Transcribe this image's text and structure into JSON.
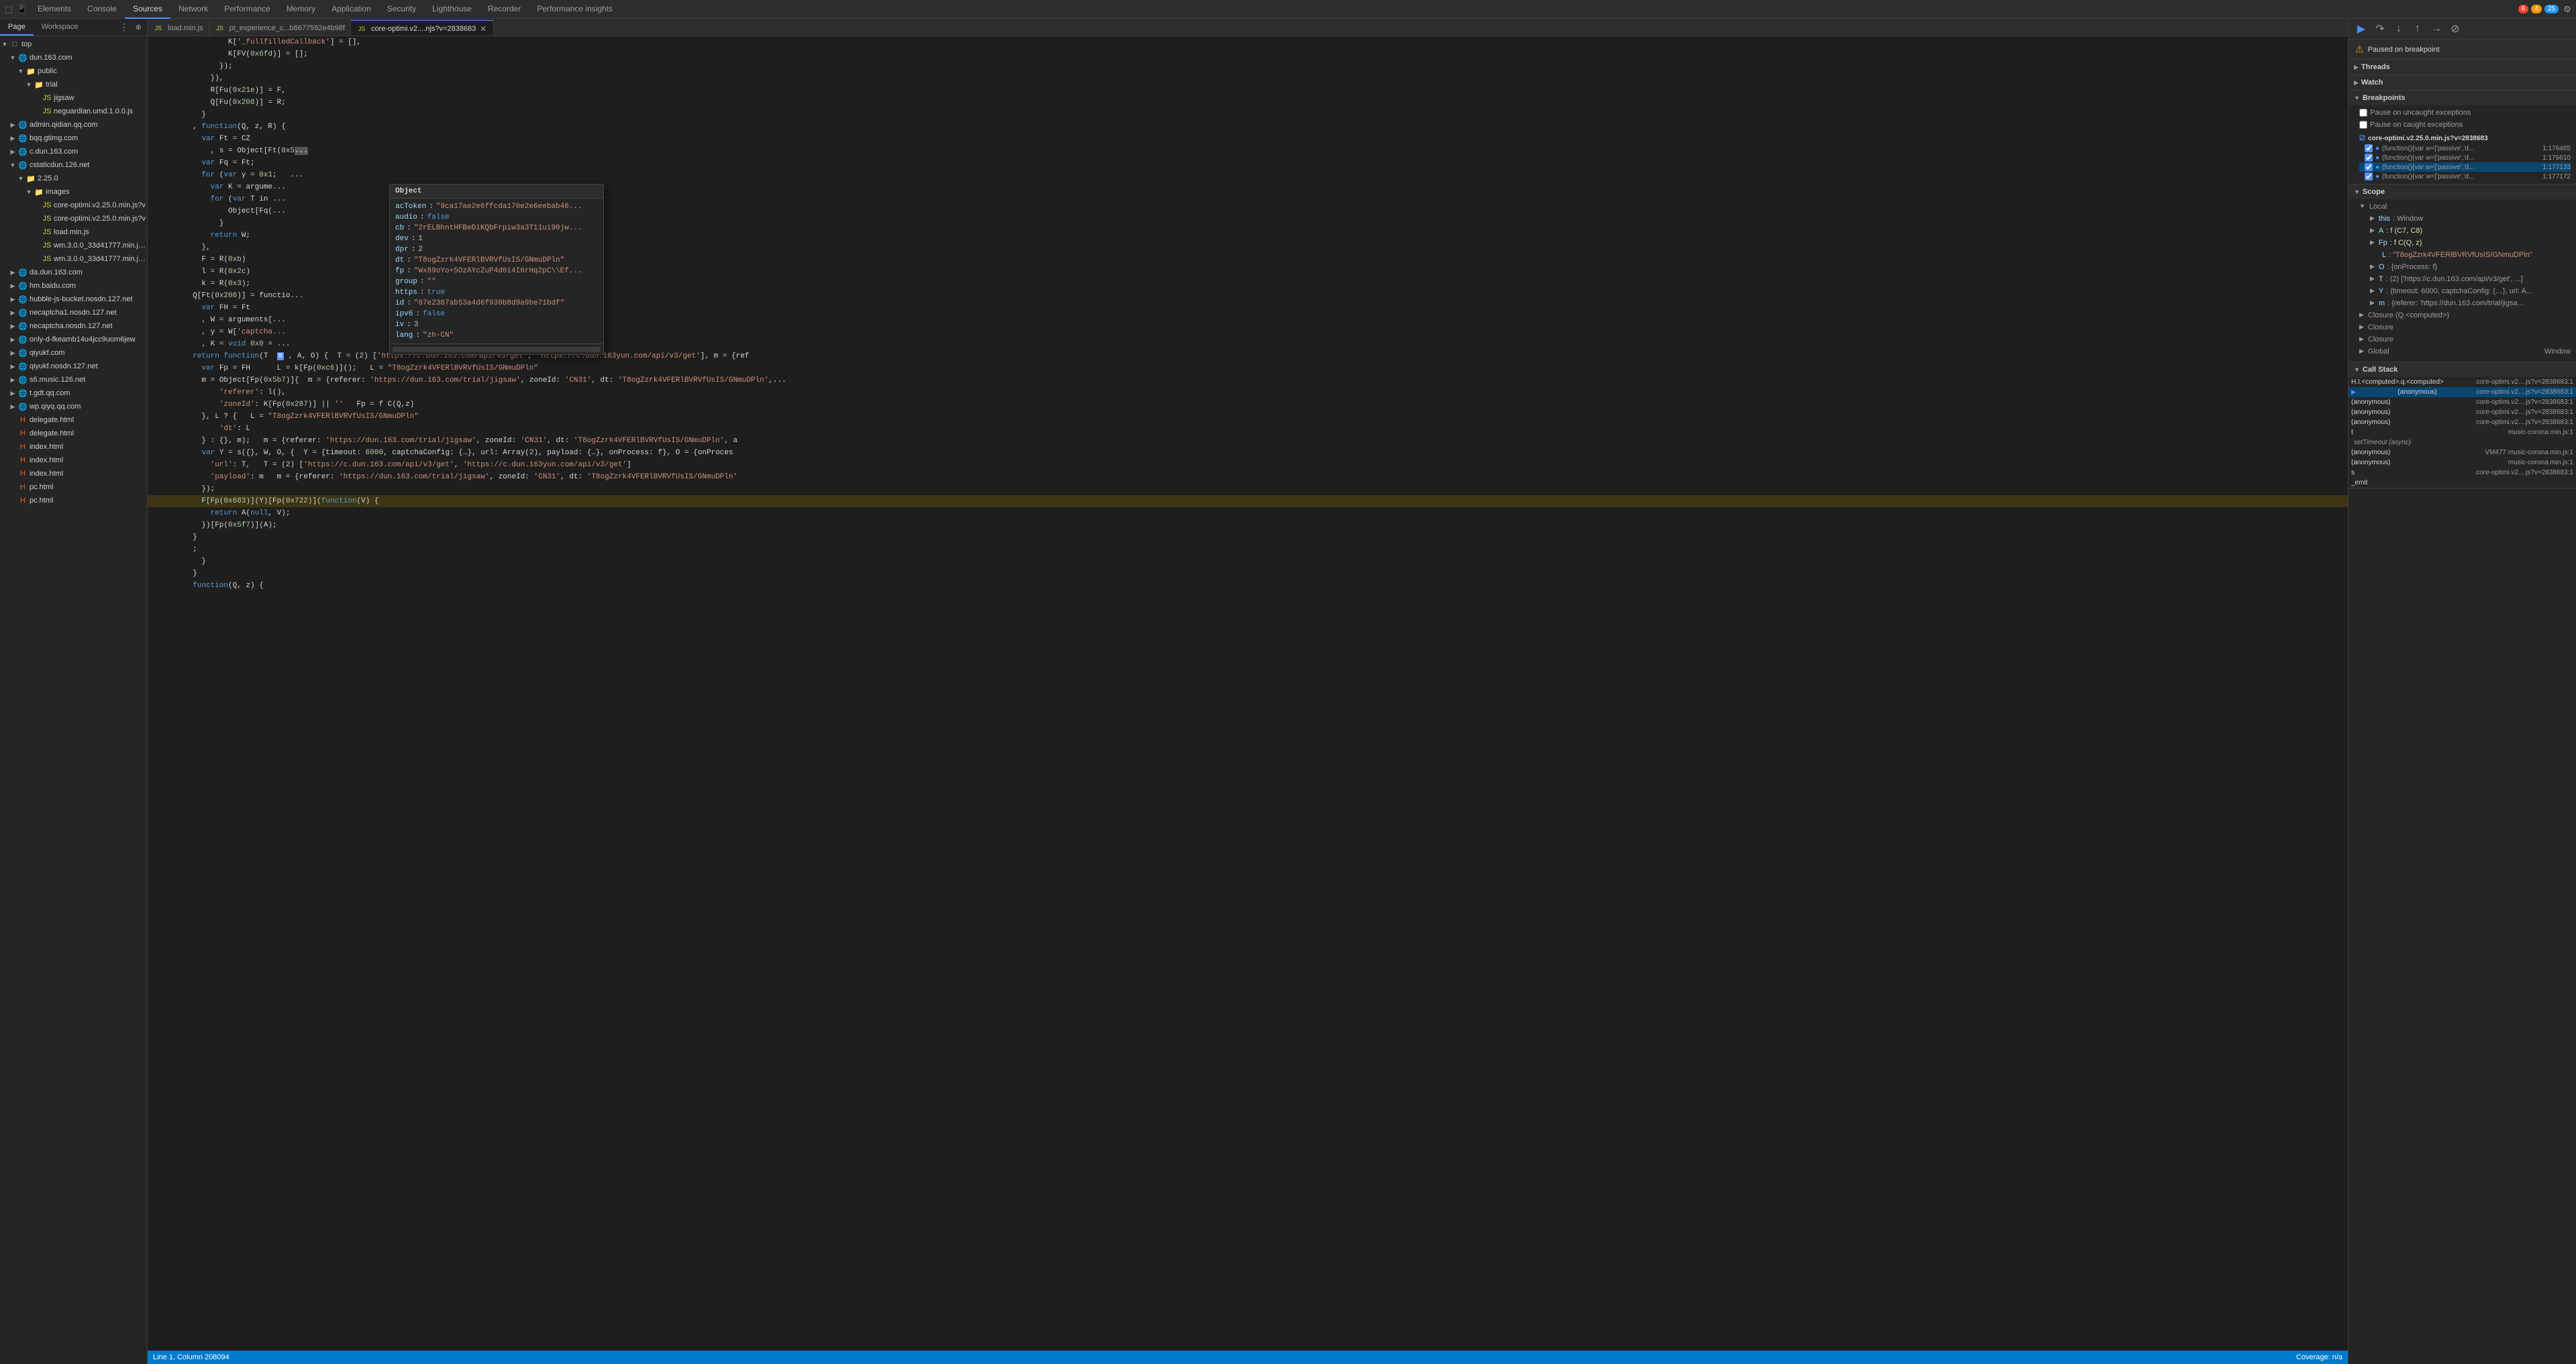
{
  "toolbar": {
    "tabs": [
      {
        "id": "elements",
        "label": "Elements",
        "active": false
      },
      {
        "id": "console",
        "label": "Console",
        "active": false
      },
      {
        "id": "sources",
        "label": "Sources",
        "active": true
      },
      {
        "id": "network",
        "label": "Network",
        "active": false
      },
      {
        "id": "performance",
        "label": "Performance",
        "active": false
      },
      {
        "id": "memory",
        "label": "Memory",
        "active": false
      },
      {
        "id": "application",
        "label": "Application",
        "active": false
      },
      {
        "id": "security",
        "label": "Security",
        "active": false
      },
      {
        "id": "lighthouse",
        "label": "Lighthouse",
        "active": false
      },
      {
        "id": "recorder",
        "label": "Recorder",
        "active": false
      },
      {
        "id": "perf-insights",
        "label": "Performance insights",
        "active": false
      }
    ],
    "error_count": "6",
    "warn_count": "4",
    "info_count": "25"
  },
  "sources_panel": {
    "tabs": [
      {
        "id": "page",
        "label": "Page",
        "active": true
      },
      {
        "id": "workspace",
        "label": "Workspace",
        "active": false
      }
    ],
    "tree": [
      {
        "indent": 0,
        "type": "folder",
        "expanded": true,
        "label": "top"
      },
      {
        "indent": 1,
        "type": "folder",
        "expanded": true,
        "label": "dun.163.com"
      },
      {
        "indent": 2,
        "type": "folder",
        "expanded": true,
        "label": "public"
      },
      {
        "indent": 3,
        "type": "folder",
        "expanded": true,
        "label": "trial"
      },
      {
        "indent": 4,
        "type": "file-js",
        "expanded": false,
        "label": "jigsaw"
      },
      {
        "indent": 4,
        "type": "file-js",
        "expanded": false,
        "label": "neguardian.umd.1.0.0.js"
      },
      {
        "indent": 1,
        "type": "folder",
        "expanded": false,
        "label": "admin.qidian.qq.com"
      },
      {
        "indent": 1,
        "type": "folder",
        "expanded": false,
        "label": "bqq.gtimg.com"
      },
      {
        "indent": 1,
        "type": "folder",
        "expanded": false,
        "label": "c.dun.163.com"
      },
      {
        "indent": 1,
        "type": "folder",
        "expanded": false,
        "label": "cstaticdun.126.net"
      },
      {
        "indent": 2,
        "type": "folder",
        "expanded": true,
        "label": "2.25.0"
      },
      {
        "indent": 3,
        "type": "folder",
        "expanded": true,
        "label": "images"
      },
      {
        "indent": 4,
        "type": "file-js",
        "expanded": false,
        "label": "core-optimi.v2.25.0.min.js?v"
      },
      {
        "indent": 4,
        "type": "file-js",
        "expanded": false,
        "label": "core-optimi.v2.25.0.min.js?v"
      },
      {
        "indent": 4,
        "type": "file-js",
        "expanded": false,
        "label": "load.min.js"
      },
      {
        "indent": 4,
        "type": "file-js",
        "expanded": false,
        "label": "wm.3.0.0_33d41777.min.js?v=2"
      },
      {
        "indent": 4,
        "type": "file-js",
        "expanded": false,
        "label": "wm.3.0.0_33d41777.min.js?v=2"
      },
      {
        "indent": 1,
        "type": "folder",
        "expanded": false,
        "label": "da.dun.163.com"
      },
      {
        "indent": 1,
        "type": "folder",
        "expanded": false,
        "label": "hm.baidu.com"
      },
      {
        "indent": 1,
        "type": "folder",
        "expanded": false,
        "label": "hubble-js-bucket.nosdn.127.net"
      },
      {
        "indent": 1,
        "type": "folder",
        "expanded": false,
        "label": "necaptcha1.nosdn.127.net"
      },
      {
        "indent": 1,
        "type": "folder",
        "expanded": false,
        "label": "necaptcha.nosdn.127.net"
      },
      {
        "indent": 1,
        "type": "folder",
        "expanded": false,
        "label": "only-d-fkeamb14u4jcc9uom6jew"
      },
      {
        "indent": 1,
        "type": "folder",
        "expanded": false,
        "label": "qiyukf.com"
      },
      {
        "indent": 1,
        "type": "folder",
        "expanded": false,
        "label": "qiyukf.nosdn.127.net"
      },
      {
        "indent": 1,
        "type": "folder",
        "expanded": false,
        "label": "s6.music.126.net"
      },
      {
        "indent": 1,
        "type": "folder",
        "expanded": false,
        "label": "t.gdt.qq.com"
      },
      {
        "indent": 1,
        "type": "folder",
        "expanded": false,
        "label": "wp.qiyq.qq.com"
      },
      {
        "indent": 1,
        "type": "file-html",
        "expanded": false,
        "label": "delegate.html"
      },
      {
        "indent": 1,
        "type": "file-html",
        "expanded": false,
        "label": "delegate.html"
      },
      {
        "indent": 1,
        "type": "file-html",
        "expanded": false,
        "label": "index.html"
      },
      {
        "indent": 1,
        "type": "file-html",
        "expanded": false,
        "label": "index.html"
      },
      {
        "indent": 1,
        "type": "file-html",
        "expanded": false,
        "label": "index.html"
      },
      {
        "indent": 1,
        "type": "file-html",
        "expanded": false,
        "label": "pc.html"
      },
      {
        "indent": 1,
        "type": "file-html",
        "expanded": false,
        "label": "pc.html"
      }
    ]
  },
  "file_tabs": [
    {
      "id": "load",
      "label": "load.min.js",
      "active": false
    },
    {
      "id": "pt_exp",
      "label": "pt_experience_c...b8677592e4b98f",
      "active": false
    },
    {
      "id": "core_optimi",
      "label": "core-optimi.v2....njs?v=2838683",
      "active": true
    }
  ],
  "code": {
    "lines": [
      {
        "num": "",
        "content": "          K['_fullfilledCallback'] = [],"
      },
      {
        "num": "",
        "content": "          K[FV(0x6fd)] = [];"
      },
      {
        "num": "",
        "content": "        });"
      },
      {
        "num": "",
        "content": "      }),"
      },
      {
        "num": "",
        "content": "      R[Fu(0x21e)] = F,"
      },
      {
        "num": "",
        "content": "      Q[Fu(0x208)] = R;"
      },
      {
        "num": "",
        "content": "    }"
      },
      {
        "num": "",
        "content": "  , function(Q, z, R) {"
      },
      {
        "num": "",
        "content": "    var Ft = CZ"
      },
      {
        "num": "",
        "content": "      , s = Object[Ft(0x5  ..."
      },
      {
        "num": "",
        "content": "    var Fq = Ft;"
      },
      {
        "num": "",
        "content": "    for (var y = 0x1;   ..."
      },
      {
        "num": "",
        "content": "      var K = argume..."
      },
      {
        "num": "",
        "content": "      for (var T in ..."
      },
      {
        "num": "",
        "content": "          Object[Fq(..."
      },
      {
        "num": "",
        "content": "        }"
      },
      {
        "num": "",
        "content": "      return W;"
      },
      {
        "num": "",
        "content": "    },"
      },
      {
        "num": "",
        "content": "    F = R(0xb)"
      },
      {
        "num": "",
        "content": "    l = R(0x2c)"
      },
      {
        "num": "",
        "content": "    k = R(0x3);"
      },
      {
        "num": "",
        "content": "  Q[Ft(0x208)] = functio..."
      },
      {
        "num": "",
        "content": "    var FH = Ft"
      },
      {
        "num": "",
        "content": "    , W = arguments[..."
      },
      {
        "num": "",
        "content": "    , y = W['captcha..."
      },
      {
        "num": "",
        "content": "    , K = void 0x0 = ..."
      },
      {
        "num": "",
        "content": "  return function(T  m , A, O) {  T = (2) ['https://c.dun.163.com/api/v3/get', 'https://c.dun.163yun.com/api/v3/get'], m = {ref"
      },
      {
        "num": "",
        "content": "    var Fp = FH      L = k[Fp(0xc6)]();   L = \"T8ogZzrk4VFERlBVRVfUsIS/GNmuDPln\""
      },
      {
        "num": "",
        "content": "    m = Object[Fp(0x5b7)]{  m = {referer: 'https://dun.163.com/trial/jigsaw', zoneId: 'CN31', dt: 'T8ogZzrk4VFERlBVRVfUsIS/GNmuDPln',..."
      },
      {
        "num": "",
        "content": "        'referer': l(),"
      },
      {
        "num": "",
        "content": "        'zoneId': K[Fp(0x287)] || ''   Fp = f C(Q,z)"
      },
      {
        "num": "",
        "content": "    }, L ? {   L = \"T8ogZzrk4VFERlBVRVfUsIS/GNmuDPln\""
      },
      {
        "num": "",
        "content": "        'dt': L"
      },
      {
        "num": "",
        "content": "    } : {}, m);   m = {referer: 'https://dun.163.com/trial/jigsaw', zoneId: 'CN31', dt: 'T8ogZzrk4VFERlBVRVfUsIS/GNmuDPln', a"
      },
      {
        "num": "",
        "content": "    var Y = s({}, W, O, {  Y = {timeout: 6000, captchaConfig: {…}, url: Array(2), payload: {…}, onProcess: f}, O = {onProces"
      },
      {
        "num": "",
        "content": "      'url': T,   T = (2) ['https://c.dun.163.com/api/v3/get', 'https://c.dun.163yun.com/api/v3/get']"
      },
      {
        "num": "",
        "content": "      'payload': m   m = {referer: 'https://dun.163.com/trial/jigsaw', zoneId: 'CN31', dt: 'T8ogZzrk4VFERlBVRVfUsIS/GNmuDPln'"
      },
      {
        "num": "",
        "content": "    });"
      },
      {
        "num": "highlighted",
        "content": "    F[Fp(0x683)](Y)[Fp(0x722)](function(V) {"
      },
      {
        "num": "",
        "content": "      return A(null, V);"
      },
      {
        "num": "",
        "content": "    })[Fp(0x5f7)](A);"
      },
      {
        "num": "",
        "content": "  }"
      },
      {
        "num": "",
        "content": "  ;"
      },
      {
        "num": "",
        "content": "    }"
      },
      {
        "num": "",
        "content": "  }"
      },
      {
        "num": "",
        "content": "  function(Q, z) {"
      }
    ]
  },
  "tooltip": {
    "header": "Object",
    "items": [
      {
        "key": "acToken",
        "val": "\"9ca17ae2e6ffcda170e2e6eebab46...\"",
        "type": "str"
      },
      {
        "key": "audio",
        "val": "false",
        "type": "bool"
      },
      {
        "key": "cb",
        "val": "\"2rELBhntHFBeDiKQbFrpiw3a3T11ui90jw...\"",
        "type": "str"
      },
      {
        "key": "dev",
        "val": "1",
        "type": "num"
      },
      {
        "key": "dpr",
        "val": "2",
        "type": "num"
      },
      {
        "key": "dt",
        "val": "\"T8ogZzrk4VFERlBVRVfUsIS/GNmuDPln\"",
        "type": "str"
      },
      {
        "key": "fp",
        "val": "\"Wx89oYo+5OzAYcZuP4d0i4I6rHq2pC\\\\Ef...\"",
        "type": "str"
      },
      {
        "key": "group",
        "val": "\"\"",
        "type": "str"
      },
      {
        "key": "https",
        "val": "true",
        "type": "bool"
      },
      {
        "key": "id",
        "val": "\"07e2387ab53a4d6f930b8d9a9be71bdf\"",
        "type": "str"
      },
      {
        "key": "ipv6",
        "val": "false",
        "type": "bool"
      },
      {
        "key": "iv",
        "val": "3",
        "type": "num"
      },
      {
        "key": "lang",
        "val": "\"zh-CN\"",
        "type": "str"
      }
    ]
  },
  "debugger": {
    "controls": [
      "resume",
      "step-over",
      "step-into",
      "step-out",
      "step",
      "deactivate"
    ],
    "breakpoint_notice": "Paused on breakpoint",
    "sections": {
      "threads": {
        "title": "Threads",
        "expanded": false
      },
      "watch": {
        "title": "Watch",
        "expanded": false
      },
      "breakpoints": {
        "title": "Breakpoints",
        "expanded": true,
        "pause_on_uncaught": "Pause on uncaught exceptions",
        "pause_on_caught": "Pause on caught exceptions",
        "file": "core-optimi.v2.25.0.min.js?v=2838683",
        "items": [
          {
            "checked": true,
            "label": "(function(){var w=['passive','d...",
            "line": "1:176465"
          },
          {
            "checked": true,
            "label": "(function(){var w=['passive','d...",
            "line": "1:176610"
          },
          {
            "checked": true,
            "label": "(function(){var w=['passive','d...",
            "line": "1:177133"
          },
          {
            "checked": true,
            "label": "(function(){var w=['passive','d...",
            "line": "1:177172"
          }
        ]
      },
      "scope": {
        "title": "Scope",
        "expanded": true,
        "local": {
          "title": "Local",
          "items": [
            {
              "key": "this",
              "val": "Window",
              "type": "obj"
            },
            {
              "key": "A",
              "val": "f (C7, C8)",
              "type": "fn"
            },
            {
              "key": "Fp",
              "val": "f C(Q, z)",
              "type": "fn"
            },
            {
              "key": "L",
              "val": "\"T8ogZzrk4VFERlBVRVfUsIS/GNmuDPln\"",
              "type": "str"
            },
            {
              "key": "O",
              "val": "{onProcess: f}",
              "type": "obj"
            },
            {
              "key": "T",
              "val": "(2) ['https://c.dun.163.com/api/v3/get', ...",
              "type": "arr"
            },
            {
              "key": "Y",
              "val": "{timeout: 6000, captchaConfig: {…}, url: A...",
              "type": "obj"
            },
            {
              "key": "m",
              "val": "{referer: 'https://dun.163.com/trial/jigsa...",
              "type": "obj"
            }
          ]
        },
        "closure_q": {
          "title": "Closure (Q.<computed>)"
        },
        "closure2": {
          "title": "Closure"
        },
        "closure3": {
          "title": "Closure"
        },
        "global": {
          "title": "Global",
          "val": "Window"
        }
      },
      "call_stack": {
        "title": "Call Stack",
        "expanded": true,
        "items": [
          {
            "name": "H.I.<computed>.q.<computed>",
            "file": "core-optimi.v2....js?v=2838683:1",
            "active": false
          },
          {
            "name": "(anonymous)",
            "file": "core-optimi.v2....js?v=2838683:1",
            "active": true,
            "arrow": true
          },
          {
            "name": "(anonymous)",
            "file": "core-optimi.v2....js?v=2838683:1",
            "active": false
          },
          {
            "name": "(anonymous)",
            "file": "core-optimi.v2....js?v=2838683:1",
            "active": false
          },
          {
            "name": "(anonymous)",
            "file": "core-optimi.v2....js?v=2838683:1",
            "active": false
          },
          {
            "name": "t",
            "file": "music-corona.min.js:1",
            "active": false
          },
          {
            "name": "setTimeout (async)",
            "file": "",
            "active": false
          },
          {
            "name": "(anonymous)",
            "file": "VM477 music-corona.min.js:1",
            "active": false
          },
          {
            "name": "(anonymous)",
            "file": "music-corona.min.js:1",
            "active": false
          },
          {
            "name": "s",
            "file": "core-optimi.v2....js?v=2838683:1",
            "active": false
          },
          {
            "name": "_emit",
            "file": "",
            "active": false
          }
        ]
      }
    }
  },
  "status_bar": {
    "position": "Line 1, Column 208094",
    "coverage": "Coverage: n/a"
  }
}
